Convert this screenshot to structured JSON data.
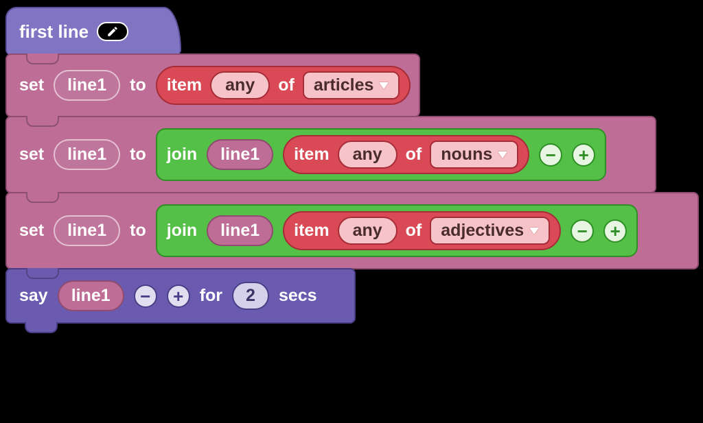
{
  "hat": {
    "title": "first line"
  },
  "labels": {
    "set": "set",
    "to": "to",
    "item": "item",
    "of": "of",
    "join": "join",
    "say": "say",
    "for": "for",
    "secs": "secs"
  },
  "rows": [
    {
      "var": "line1",
      "item_index": "any",
      "list": "articles"
    },
    {
      "var": "line1",
      "join_var": "line1",
      "item_index": "any",
      "list": "nouns"
    },
    {
      "var": "line1",
      "join_var": "line1",
      "item_index": "any",
      "list": "adjectives"
    }
  ],
  "say": {
    "var": "line1",
    "duration": "2"
  },
  "glyphs": {
    "minus": "−",
    "plus": "+"
  }
}
